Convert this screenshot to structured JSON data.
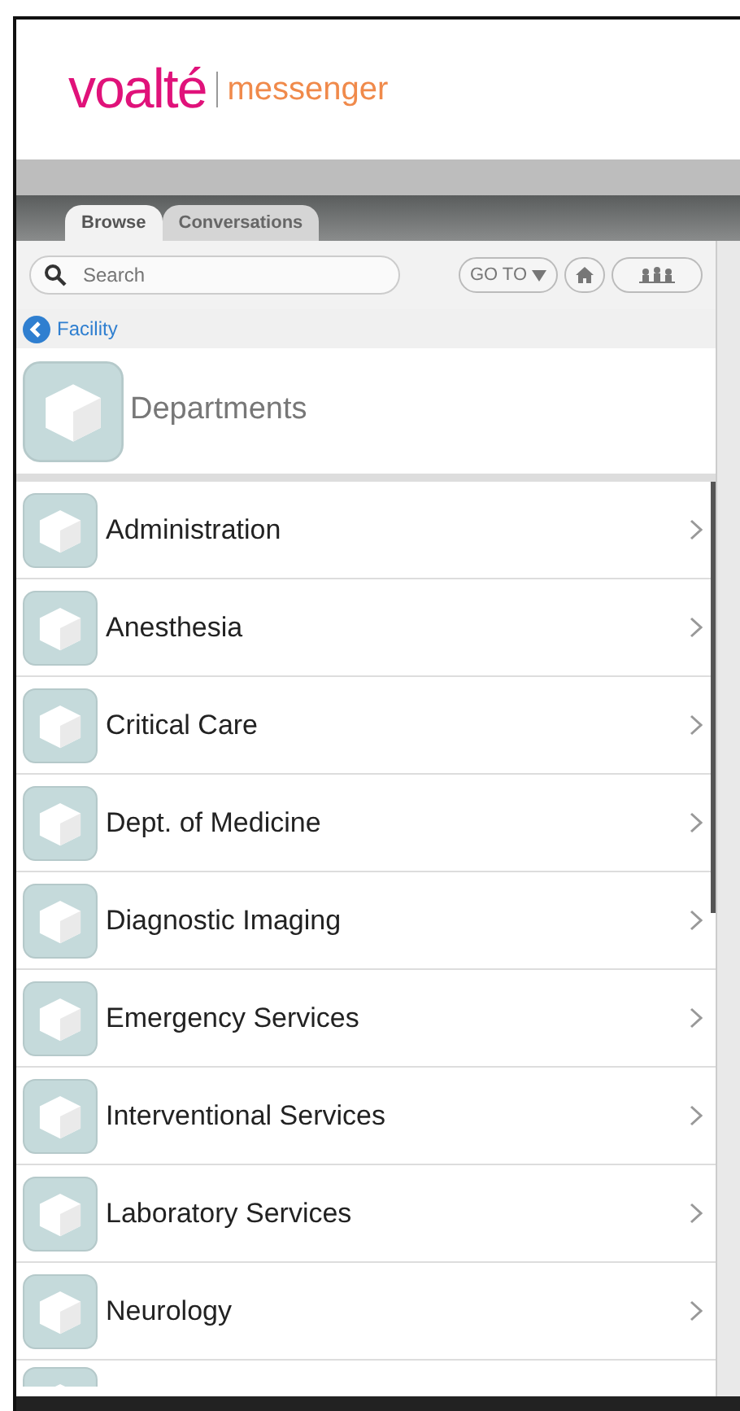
{
  "logo": {
    "brand": "voalté",
    "product": "messenger"
  },
  "tabs": [
    {
      "label": "Browse",
      "selected": true
    },
    {
      "label": "Conversations",
      "selected": false
    }
  ],
  "search": {
    "placeholder": "Search"
  },
  "goto_button": "GO TO",
  "breadcrumb": "Facility",
  "header": "Departments",
  "departments": [
    "Administration",
    "Anesthesia",
    "Critical Care",
    "Dept. of Medicine",
    "Diagnostic Imaging",
    "Emergency Services",
    "Interventional Services",
    "Laboratory Services",
    "Neurology"
  ]
}
